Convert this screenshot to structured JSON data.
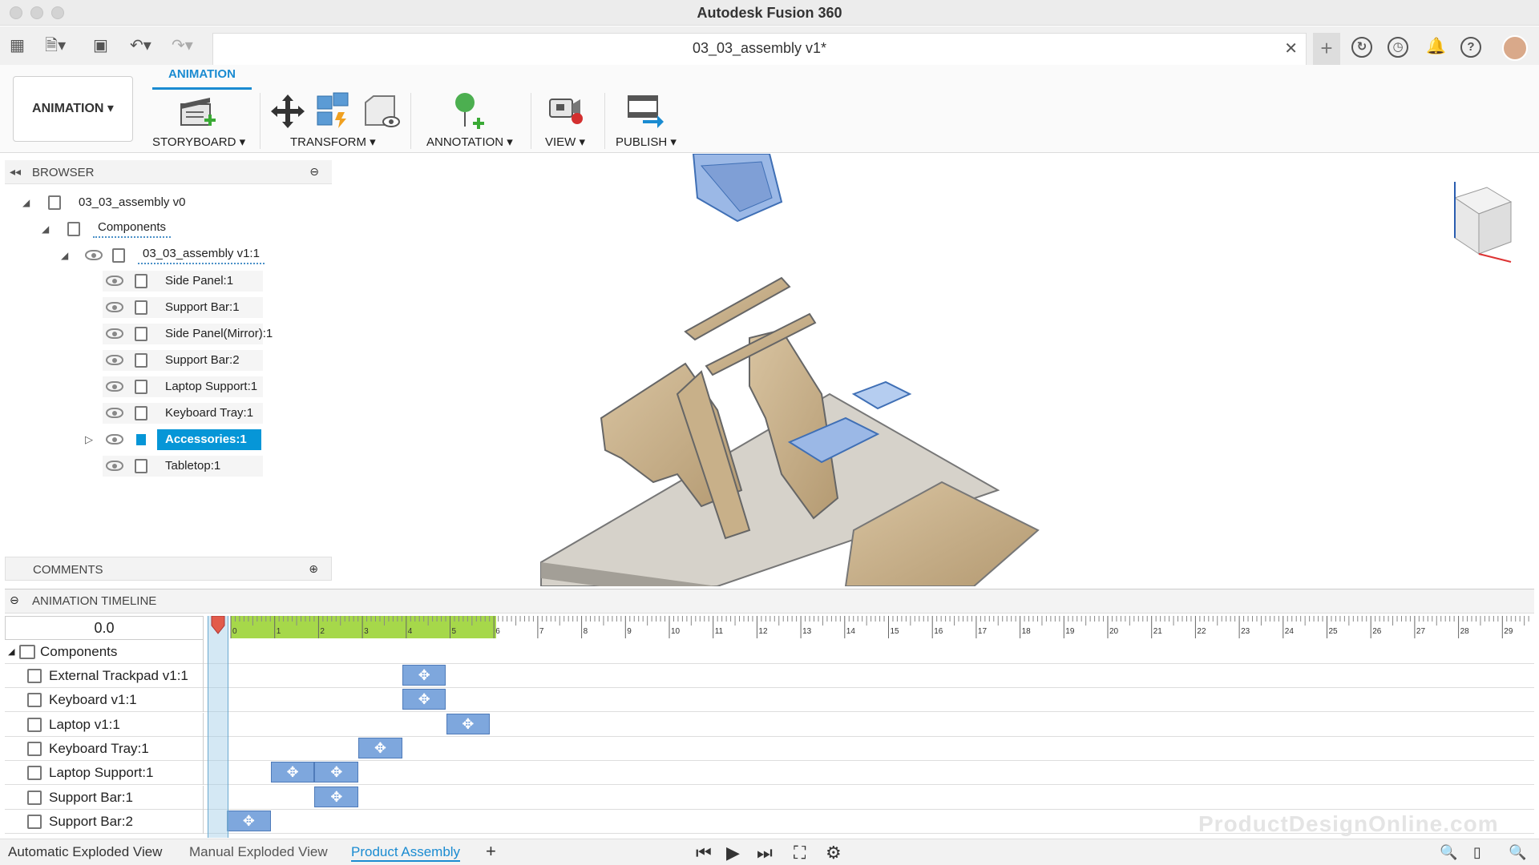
{
  "window": {
    "title": "Autodesk Fusion 360"
  },
  "document_tab": {
    "title": "03_03_assembly v1*",
    "close_glyph": "✕"
  },
  "ribbon": {
    "workspace_label": "ANIMATION ▾",
    "active_tab": "ANIMATION",
    "groups": {
      "storyboard": "STORYBOARD ▾",
      "transform": "TRANSFORM ▾",
      "annotation": "ANNOTATION ▾",
      "view": "VIEW ▾",
      "publish": "PUBLISH ▾"
    }
  },
  "browser": {
    "title": "BROWSER",
    "root": "03_03_assembly v0",
    "components_label": "Components",
    "subassembly": "03_03_assembly v1:1",
    "items": [
      {
        "label": "Side Panel:1"
      },
      {
        "label": "Support Bar:1"
      },
      {
        "label": "Side Panel(Mirror):1"
      },
      {
        "label": "Support Bar:2"
      },
      {
        "label": "Laptop Support:1"
      },
      {
        "label": "Keyboard Tray:1"
      },
      {
        "label": "Accessories:1",
        "selected": true
      },
      {
        "label": "Tabletop:1"
      }
    ]
  },
  "comments": {
    "title": "COMMENTS"
  },
  "timeline": {
    "title": "ANIMATION TIMELINE",
    "current_time": "0.0",
    "ruler_ticks": [
      "0",
      "1",
      "2",
      "3",
      "4",
      "5",
      "6",
      "7",
      "8",
      "9",
      "10",
      "11",
      "12",
      "13",
      "14",
      "15",
      "16",
      "17",
      "18",
      "19",
      "20",
      "21",
      "22",
      "23",
      "24",
      "25",
      "26",
      "27",
      "28",
      "29"
    ],
    "group_label": "Components",
    "rows": [
      {
        "label": "External Trackpad v1:1",
        "keys": [
          {
            "start": 4,
            "end": 5
          }
        ]
      },
      {
        "label": "Keyboard v1:1",
        "keys": [
          {
            "start": 4,
            "end": 5
          }
        ]
      },
      {
        "label": "Laptop v1:1",
        "keys": [
          {
            "start": 5,
            "end": 6
          }
        ]
      },
      {
        "label": "Keyboard Tray:1",
        "keys": [
          {
            "start": 3,
            "end": 4
          }
        ]
      },
      {
        "label": "Laptop Support:1",
        "keys": [
          {
            "start": 1,
            "end": 2
          },
          {
            "start": 2,
            "end": 3
          }
        ]
      },
      {
        "label": "Support Bar:1",
        "keys": [
          {
            "start": 2,
            "end": 3
          }
        ]
      },
      {
        "label": "Support Bar:2",
        "keys": [
          {
            "start": 0,
            "end": 1
          }
        ]
      }
    ]
  },
  "storyboards": {
    "tabs": [
      {
        "label": "Automatic Exploded View"
      },
      {
        "label": "Manual Exploded View"
      },
      {
        "label": "Product Assembly",
        "active": true
      }
    ],
    "add_glyph": "+"
  },
  "watermark": "ProductDesignOnline.com",
  "colors": {
    "accent": "#0696d7",
    "keyframe": "#7ea7dd",
    "timeline_green": "#a6d84a"
  }
}
